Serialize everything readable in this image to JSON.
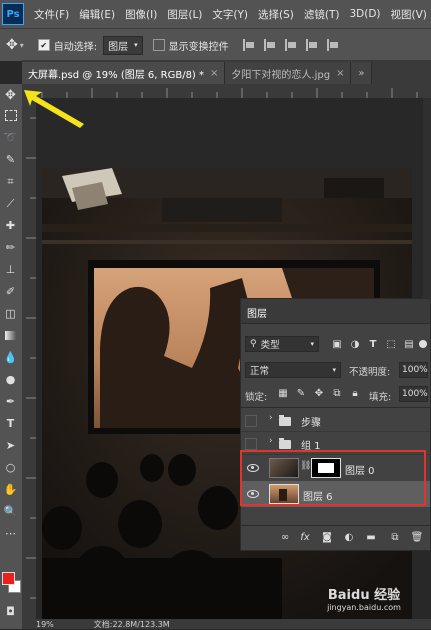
{
  "app": {
    "logo": "Ps"
  },
  "menu": [
    "文件(F)",
    "编辑(E)",
    "图像(I)",
    "图层(L)",
    "文字(Y)",
    "选择(S)",
    "滤镜(T)",
    "3D(D)",
    "视图(V)"
  ],
  "options": {
    "auto_select_label": "自动选择:",
    "auto_select_value": "图层",
    "show_transform_label": "显示变换控件"
  },
  "tabs": [
    {
      "label": "大屏幕.psd @ 19% (图层 6, RGB/8) *",
      "close": "×",
      "active": true
    },
    {
      "label": "夕阳下对视的恋人.jpg",
      "close": "×",
      "active": false
    }
  ],
  "layers_panel": {
    "title": "图层",
    "filter_kind": "类型",
    "blend_mode": "正常",
    "opacity_label": "不透明度:",
    "opacity_value": "100%",
    "lock_label": "锁定:",
    "fill_label": "填充:",
    "fill_value": "100%",
    "layers": [
      {
        "name": "步骤",
        "type": "group",
        "visible": false
      },
      {
        "name": "组 1",
        "type": "group",
        "visible": false
      },
      {
        "name": "图层 0",
        "type": "layer-with-mask",
        "visible": true
      },
      {
        "name": "图层 6",
        "type": "layer",
        "visible": true,
        "selected": true
      }
    ],
    "footer_icons": [
      "link-icon",
      "fx-icon",
      "mask-icon",
      "adjustment-icon",
      "folder-icon",
      "new-layer-icon",
      "trash-icon"
    ]
  },
  "status": {
    "zoom": "19%",
    "doc_info": "文档:22.8M/123.3M"
  },
  "watermark": {
    "line1": "Baidu 经验",
    "line2": "jingyan.baidu.com"
  },
  "colors": {
    "foreground": "#e8211b",
    "background": "#ffffff",
    "highlight": "#e0342f",
    "arrow": "#f5e21a"
  }
}
